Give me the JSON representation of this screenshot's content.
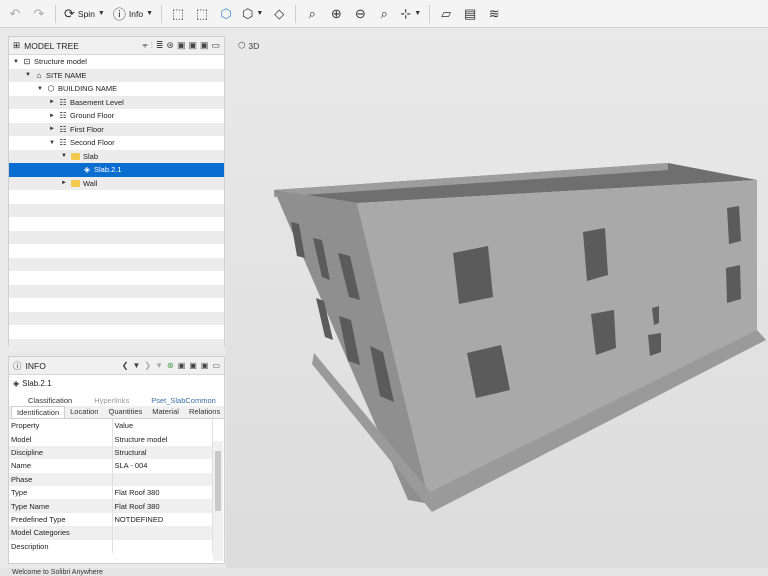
{
  "toolbar": {
    "spin_label": "Spin",
    "info_label": "Info"
  },
  "viewport": {
    "label": "3D"
  },
  "model_tree": {
    "title": "MODEL TREE",
    "rows": [
      {
        "label": "Structure model",
        "indent": 0,
        "toggle": "▼",
        "icon": "structure-model-icon"
      },
      {
        "label": "SITE NAME",
        "indent": 1,
        "toggle": "▼",
        "icon": "site-icon"
      },
      {
        "label": "BUILDING NAME",
        "indent": 2,
        "toggle": "▼",
        "icon": "building-icon"
      },
      {
        "label": "Basement Level",
        "indent": 3,
        "toggle": "►",
        "icon": "level-icon"
      },
      {
        "label": "Ground Floor",
        "indent": 3,
        "toggle": "►",
        "icon": "level-icon"
      },
      {
        "label": "First Floor",
        "indent": 3,
        "toggle": "►",
        "icon": "level-icon"
      },
      {
        "label": "Second Floor",
        "indent": 3,
        "toggle": "▼",
        "icon": "level-icon"
      },
      {
        "label": "Slab",
        "indent": 4,
        "toggle": "▼",
        "icon": "folder-icon"
      },
      {
        "label": "Slab.2.1",
        "indent": 5,
        "toggle": "",
        "icon": "slab-icon",
        "selected": true
      },
      {
        "label": "Wall",
        "indent": 4,
        "toggle": "►",
        "icon": "folder-icon"
      }
    ]
  },
  "info": {
    "title": "INFO",
    "selected_name": "Slab.2.1",
    "tabs_row1": [
      "Classification",
      "Hyperlinks",
      "Pset_SlabCommon"
    ],
    "tabs_row2": [
      "Identification",
      "Location",
      "Quantities",
      "Material",
      "Relations"
    ],
    "columns": [
      "Property",
      "Value"
    ],
    "properties": [
      {
        "property": "Model",
        "value": "Structure model"
      },
      {
        "property": "Discipline",
        "value": "Structural"
      },
      {
        "property": "Name",
        "value": "SLA - 004"
      },
      {
        "property": "Phase",
        "value": ""
      },
      {
        "property": "Type",
        "value": "Flat Roof 380"
      },
      {
        "property": "Type Name",
        "value": "Flat Roof 380"
      },
      {
        "property": "Predefined Type",
        "value": "NOTDEFINED"
      },
      {
        "property": "Model Categories",
        "value": ""
      },
      {
        "property": "Description",
        "value": ""
      }
    ]
  },
  "status": {
    "text": "Welcome to Solibri Anywhere"
  },
  "colors": {
    "selection": "#0a6ed1",
    "folder": "#f2c94c",
    "building_front": "#a9a9a9",
    "building_side": "#8f8f8f"
  }
}
